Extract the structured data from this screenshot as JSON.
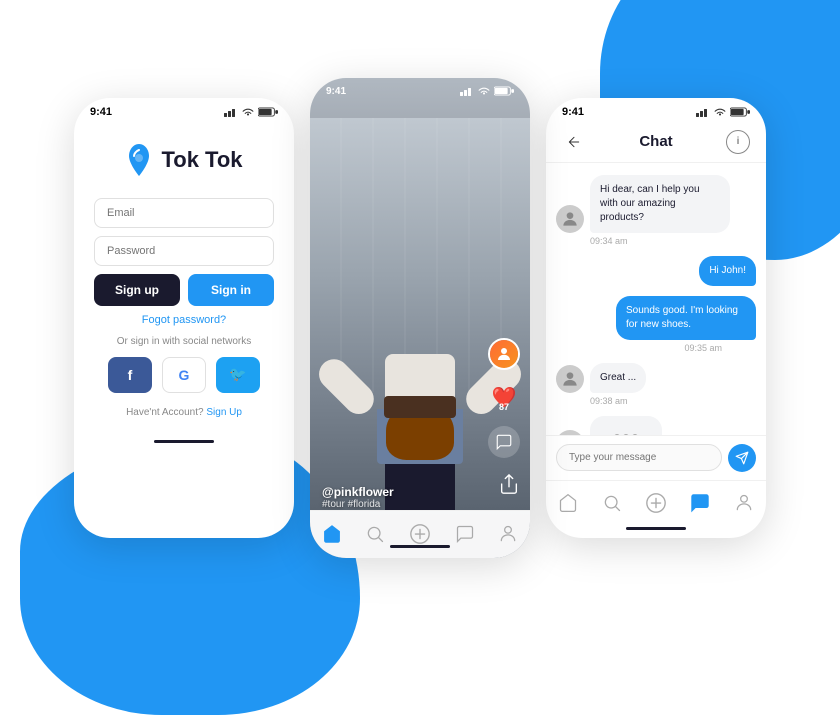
{
  "background": {
    "blob_color": "#2196F3"
  },
  "phone_login": {
    "status_bar": {
      "time": "9:41",
      "signal": "▲▲▲",
      "wifi": "wifi",
      "battery": "battery"
    },
    "logo_text": "Tok Tok",
    "email_placeholder": "Email",
    "password_placeholder": "Password",
    "signup_button": "Sign up",
    "signin_button": "Sign in",
    "forgot_password": "Fogot password?",
    "social_label": "Or sign in with social networks",
    "social_facebook": "f",
    "social_google": "G",
    "social_twitter": "t",
    "register_text": "Have'nt Account?",
    "register_link": "Sign Up"
  },
  "phone_feed": {
    "status_bar": {
      "time": "9:41"
    },
    "username": "@pinkflower",
    "tags": "#tour #florida",
    "heart_count": "87",
    "nav": {
      "home": "home",
      "search": "search",
      "add": "add",
      "chat": "chat",
      "profile": "profile"
    }
  },
  "phone_chat": {
    "status_bar": {
      "time": "9:41"
    },
    "title": "Chat",
    "messages": [
      {
        "type": "received",
        "text": "Hi dear, can I help you with our amazing products?",
        "time": "09:34 am"
      },
      {
        "type": "sent",
        "text": "Hi John!"
      },
      {
        "type": "sent",
        "text": "Sounds good. I'm looking for new shoes.",
        "time": "09:35 am"
      },
      {
        "type": "received",
        "text": "Great ...",
        "time": "09:38 am"
      },
      {
        "type": "typing"
      }
    ],
    "input_placeholder": "Type your message",
    "nav": {
      "home": "home",
      "search": "search",
      "add": "add",
      "chat_active": "chat",
      "profile": "profile"
    }
  }
}
